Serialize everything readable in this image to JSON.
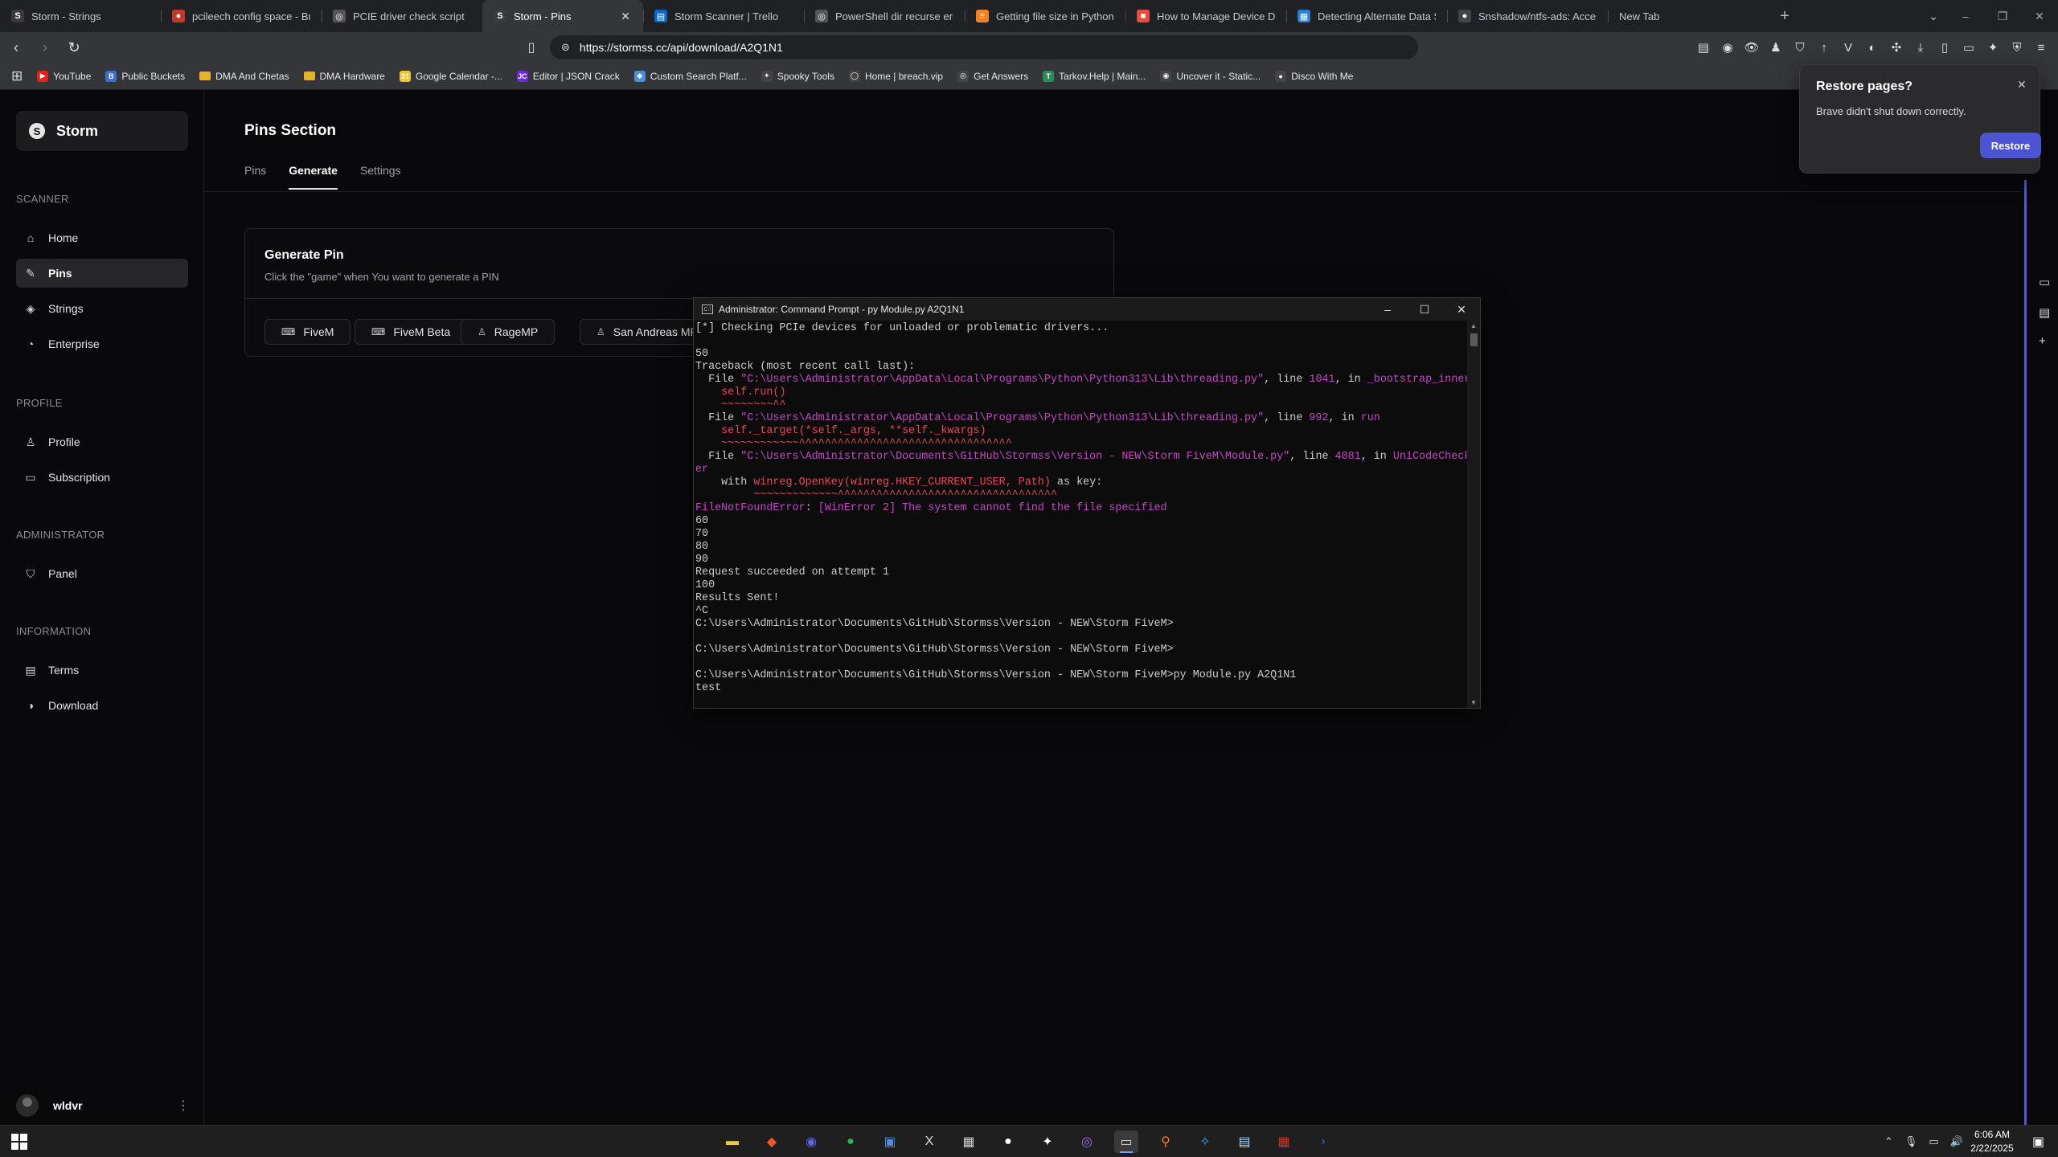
{
  "tabs": [
    {
      "title": "Storm - Strings",
      "icon": "storm-icon",
      "color": "#3a3a3e",
      "glyph": "S"
    },
    {
      "title": "pcileech config space - Brave",
      "icon": "brave-search-icon",
      "color": "#c0392b",
      "glyph": "●"
    },
    {
      "title": "PCIE driver check script",
      "icon": "chatgpt-icon",
      "color": "#555",
      "glyph": "◎"
    },
    {
      "title": "Storm - Pins",
      "icon": "storm-icon",
      "color": "#3a3a3e",
      "glyph": "S",
      "active": true
    },
    {
      "title": "Storm Scanner | Trello",
      "icon": "trello-icon",
      "color": "#0b66c3",
      "glyph": "▤"
    },
    {
      "title": "PowerShell dir recurse error",
      "icon": "chatgpt-icon",
      "color": "#555",
      "glyph": "◎"
    },
    {
      "title": "Getting file size in Python? - St",
      "icon": "stackoverflow-icon",
      "color": "#f48024",
      "glyph": "≡"
    },
    {
      "title": "How to Manage Device Driver",
      "icon": "microsoft-icon",
      "color": "#e74c3c",
      "glyph": "■"
    },
    {
      "title": "Detecting Alternate Data Strea",
      "icon": "site-icon",
      "color": "#2a7fd4",
      "glyph": "▦"
    },
    {
      "title": "Snshadow/ntfs-ads: Access NT",
      "icon": "github-icon",
      "color": "#444",
      "glyph": "●"
    },
    {
      "title": "New Tab",
      "icon": "",
      "color": "transparent",
      "glyph": ""
    }
  ],
  "url": "https://stormss.cc/api/download/A2Q1N1",
  "bookmarks": [
    {
      "label": "YouTube",
      "color": "#e62117",
      "glyph": "▶"
    },
    {
      "label": "Public Buckets",
      "color": "#3b6fd6",
      "glyph": "B"
    },
    {
      "label": "DMA And Chetas",
      "color": "#e6b422",
      "glyph": ""
    },
    {
      "label": "DMA Hardware",
      "color": "#e6b422",
      "glyph": ""
    },
    {
      "label": "Google Calendar -...",
      "color": "#f1c232",
      "glyph": "31"
    },
    {
      "label": "Editor | JSON Crack",
      "color": "#6c2bd9",
      "glyph": "JC"
    },
    {
      "label": "Custom Search Platf...",
      "color": "#4a90d9",
      "glyph": "◆"
    },
    {
      "label": "Spooky Tools",
      "color": "#444",
      "glyph": "✦"
    },
    {
      "label": "Home | breach.vip",
      "color": "#444",
      "glyph": "◯"
    },
    {
      "label": "Get Answers",
      "color": "#444",
      "glyph": "◎"
    },
    {
      "label": "Tarkov.Help | Main...",
      "color": "#2e8b57",
      "glyph": "T"
    },
    {
      "label": "Uncover it - Static...",
      "color": "#444",
      "glyph": "◉"
    },
    {
      "label": "Disco With Me",
      "color": "#444",
      "glyph": "●"
    }
  ],
  "sidebar": {
    "brand": "Storm",
    "sections": [
      {
        "title": "SCANNER",
        "items": [
          {
            "label": "Home",
            "icon": "home-icon",
            "glyph": "⌂"
          },
          {
            "label": "Pins",
            "icon": "pin-icon",
            "glyph": "✎",
            "active": true
          },
          {
            "label": "Strings",
            "icon": "layers-icon",
            "glyph": "◈"
          },
          {
            "label": "Enterprise",
            "icon": "globe-icon",
            "glyph": "◔"
          }
        ]
      },
      {
        "title": "PROFILE",
        "items": [
          {
            "label": "Profile",
            "icon": "user-icon",
            "glyph": "♙"
          },
          {
            "label": "Subscription",
            "icon": "card-icon",
            "glyph": "▭"
          }
        ]
      },
      {
        "title": "ADMINISTRATOR",
        "items": [
          {
            "label": "Panel",
            "icon": "shield-icon",
            "glyph": "⛉"
          }
        ]
      },
      {
        "title": "INFORMATION",
        "items": [
          {
            "label": "Terms",
            "icon": "document-icon",
            "glyph": "▤"
          },
          {
            "label": "Download",
            "icon": "download-icon",
            "glyph": "◑"
          }
        ]
      }
    ],
    "username": "wldvr"
  },
  "main": {
    "title": "Pins Section",
    "tabs": [
      {
        "label": "Pins"
      },
      {
        "label": "Generate",
        "active": true
      },
      {
        "label": "Settings"
      }
    ],
    "card": {
      "title": "Generate Pin",
      "subtitle": "Click the \"game\" when You want to generate a PIN",
      "buttons": [
        {
          "label": "FiveM",
          "icon": "gamepad-icon"
        },
        {
          "label": "FiveM Beta",
          "icon": "gamepad-icon"
        },
        {
          "label": "RageMP",
          "icon": "user-icon"
        },
        {
          "label": "San Andreas MP",
          "icon": "user-icon"
        }
      ]
    }
  },
  "cmd": {
    "title": "Administrator: Command Prompt - py  Module.py A2Q1N1",
    "lines": [
      [
        {
          "t": "[*] Checking PCIe devices for unloaded or problematic drivers...",
          "c": "wt"
        }
      ],
      [
        {
          "t": "",
          "c": "wt"
        }
      ],
      [
        {
          "t": "50",
          "c": "wt"
        }
      ],
      [
        {
          "t": "Traceback (most recent call last):",
          "c": "wt"
        }
      ],
      [
        {
          "t": "  File ",
          "c": "wt"
        },
        {
          "t": "\"C:\\Users\\Administrator\\AppData\\Local\\Programs\\Python\\Python313\\Lib\\threading.py\"",
          "c": "mg"
        },
        {
          "t": ", line ",
          "c": "wt"
        },
        {
          "t": "1041",
          "c": "mg"
        },
        {
          "t": ", in ",
          "c": "wt"
        },
        {
          "t": "_bootstrap_inner",
          "c": "mg"
        }
      ],
      [
        {
          "t": "    self.run()",
          "c": "rd"
        }
      ],
      [
        {
          "t": "    ~~~~~~~~^^",
          "c": "rd"
        }
      ],
      [
        {
          "t": "  File ",
          "c": "wt"
        },
        {
          "t": "\"C:\\Users\\Administrator\\AppData\\Local\\Programs\\Python\\Python313\\Lib\\threading.py\"",
          "c": "mg"
        },
        {
          "t": ", line ",
          "c": "wt"
        },
        {
          "t": "992",
          "c": "mg"
        },
        {
          "t": ", in ",
          "c": "wt"
        },
        {
          "t": "run",
          "c": "mg"
        }
      ],
      [
        {
          "t": "    self._target(*self._args, **self._kwargs)",
          "c": "rd"
        }
      ],
      [
        {
          "t": "    ~~~~~~~~~~~~^^^^^^^^^^^^^^^^^^^^^^^^^^^^^^^^^",
          "c": "rd"
        }
      ],
      [
        {
          "t": "  File ",
          "c": "wt"
        },
        {
          "t": "\"C:\\Users\\Administrator\\Documents\\GitHub\\Stormss\\Version - NEW\\Storm FiveM\\Module.py\"",
          "c": "mg"
        },
        {
          "t": ", line ",
          "c": "wt"
        },
        {
          "t": "4081",
          "c": "mg"
        },
        {
          "t": ", in ",
          "c": "wt"
        },
        {
          "t": "UniCodeCheck",
          "c": "mg"
        }
      ],
      [
        {
          "t": "er",
          "c": "mg"
        }
      ],
      [
        {
          "t": "    with ",
          "c": "wt"
        },
        {
          "t": "winreg.OpenKey",
          "c": "rd"
        },
        {
          "t": "(winreg.HKEY_CURRENT_USER, Path)",
          "c": "rd"
        },
        {
          "t": " as key:",
          "c": "wt"
        }
      ],
      [
        {
          "t": "         ~~~~~~~~~~~~~^^^^^^^^^^^^^^^^^^^^^^^^^^^^^^^^^^",
          "c": "rd"
        }
      ],
      [
        {
          "t": "FileNotFoundError",
          "c": "mg"
        },
        {
          "t": ": ",
          "c": "wt"
        },
        {
          "t": "[WinError 2] The system cannot find the file specified",
          "c": "mg"
        }
      ],
      [
        {
          "t": "60",
          "c": "wt"
        }
      ],
      [
        {
          "t": "70",
          "c": "wt"
        }
      ],
      [
        {
          "t": "80",
          "c": "wt"
        }
      ],
      [
        {
          "t": "90",
          "c": "wt"
        }
      ],
      [
        {
          "t": "Request succeeded on attempt 1",
          "c": "wt"
        }
      ],
      [
        {
          "t": "100",
          "c": "wt"
        }
      ],
      [
        {
          "t": "Results Sent!",
          "c": "wt"
        }
      ],
      [
        {
          "t": "^C",
          "c": "wt"
        }
      ],
      [
        {
          "t": "C:\\Users\\Administrator\\Documents\\GitHub\\Stormss\\Version - NEW\\Storm FiveM>",
          "c": "wt"
        }
      ],
      [
        {
          "t": "",
          "c": "wt"
        }
      ],
      [
        {
          "t": "C:\\Users\\Administrator\\Documents\\GitHub\\Stormss\\Version - NEW\\Storm FiveM>",
          "c": "wt"
        }
      ],
      [
        {
          "t": "",
          "c": "wt"
        }
      ],
      [
        {
          "t": "C:\\Users\\Administrator\\Documents\\GitHub\\Stormss\\Version - NEW\\Storm FiveM>py Module.py A2Q1N1",
          "c": "wt"
        }
      ],
      [
        {
          "t": "test",
          "c": "wt"
        }
      ]
    ]
  },
  "restore_popup": {
    "title": "Restore pages?",
    "message": "Brave didn't shut down correctly.",
    "button": "Restore"
  },
  "taskbar": {
    "apps": [
      {
        "icon": "file-explorer-icon",
        "glyph": "▬",
        "color": "#f4c542"
      },
      {
        "icon": "brave-icon",
        "glyph": "◆",
        "color": "#fb542b"
      },
      {
        "icon": "discord-icon",
        "glyph": "◉",
        "color": "#5865f2"
      },
      {
        "icon": "spotify-icon",
        "glyph": "●",
        "color": "#1db954"
      },
      {
        "icon": "remote-desktop-icon",
        "glyph": "▣",
        "color": "#4a8fe7"
      },
      {
        "icon": "excel-icon",
        "glyph": "X",
        "color": "#dddddd"
      },
      {
        "icon": "monitor-app-icon",
        "glyph": "▦",
        "color": "#cfcfcf"
      },
      {
        "icon": "app-icon",
        "glyph": "●",
        "color": "#ffffff"
      },
      {
        "icon": "ida-icon",
        "glyph": "✦",
        "color": "#ffffff"
      },
      {
        "icon": "github-desktop-icon",
        "glyph": "◎",
        "color": "#a371f7"
      },
      {
        "icon": "terminal-icon",
        "glyph": "▭",
        "color": "#dddddd",
        "active": true
      },
      {
        "icon": "search-app-icon",
        "glyph": "⚲",
        "color": "#ff7a1a"
      },
      {
        "icon": "vscode-icon",
        "glyph": "✧",
        "color": "#3ea6f3"
      },
      {
        "icon": "notepad-icon",
        "glyph": "▤",
        "color": "#a8d8ff"
      },
      {
        "icon": "winrar-icon",
        "glyph": "▦",
        "color": "#c0392b"
      },
      {
        "icon": "powershell-icon",
        "glyph": "›",
        "color": "#2a6bd4"
      }
    ],
    "time": "6:06 AM",
    "date": "2/22/2025"
  }
}
